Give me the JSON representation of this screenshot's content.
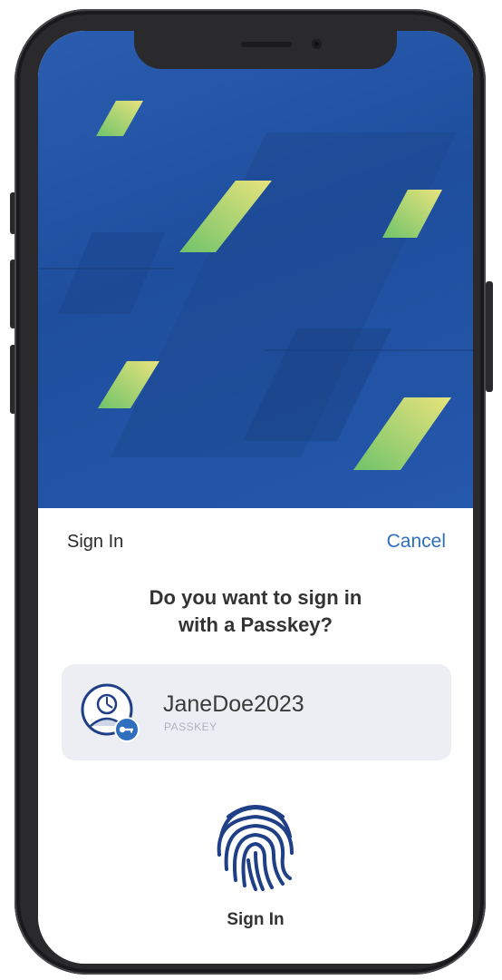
{
  "sheet": {
    "title": "Sign In",
    "cancel_label": "Cancel",
    "question_line1": "Do you want to sign in",
    "question_line2": "with a Passkey?"
  },
  "account": {
    "username": "JaneDoe2023",
    "type_label": "PASSKEY",
    "avatar_icon": "user-avatar-icon",
    "badge_icon": "key-icon"
  },
  "action": {
    "icon": "fingerprint-icon",
    "label": "Sign In"
  },
  "colors": {
    "hero_blue": "#2458ab",
    "accent_blue": "#2f6fbe",
    "card_bg": "#eceef3",
    "shape_green": "#7ec96a",
    "shape_yellow": "#e6e27a"
  }
}
